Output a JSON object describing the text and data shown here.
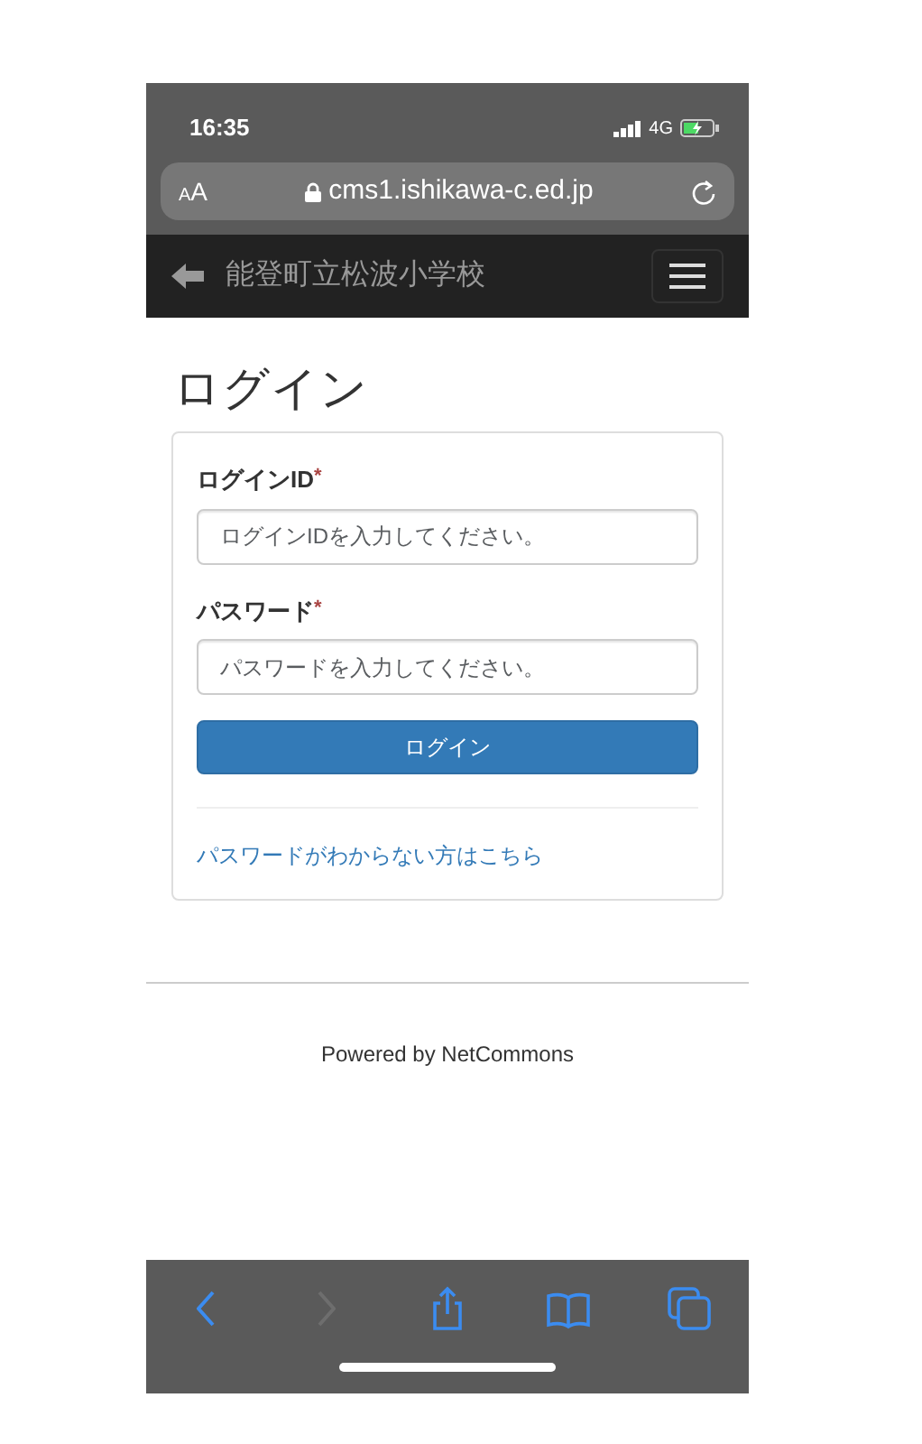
{
  "status_bar": {
    "time": "16:35",
    "network": "4G",
    "battery_charging": true
  },
  "address_bar": {
    "text_size_button": "AA",
    "url": "cms1.ishikawa-c.ed.jp",
    "secure": true
  },
  "navbar": {
    "title": "能登町立松波小学校"
  },
  "page": {
    "heading": "ログイン",
    "fields": [
      {
        "label": "ログインID",
        "required_mark": "*",
        "placeholder": "ログインIDを入力してください。"
      },
      {
        "label": "パスワード",
        "required_mark": "*",
        "placeholder": "パスワードを入力してください。"
      }
    ],
    "submit_button": "ログイン",
    "forgot_link": "パスワードがわからない方はこちら"
  },
  "footer": {
    "text": "Powered by NetCommons"
  },
  "toolbar": [
    {
      "kind": "back",
      "disabled": false
    },
    {
      "kind": "forward",
      "disabled": true
    },
    {
      "kind": "share",
      "disabled": false
    },
    {
      "kind": "bookmarks",
      "disabled": false
    },
    {
      "kind": "tabs",
      "disabled": false
    }
  ]
}
